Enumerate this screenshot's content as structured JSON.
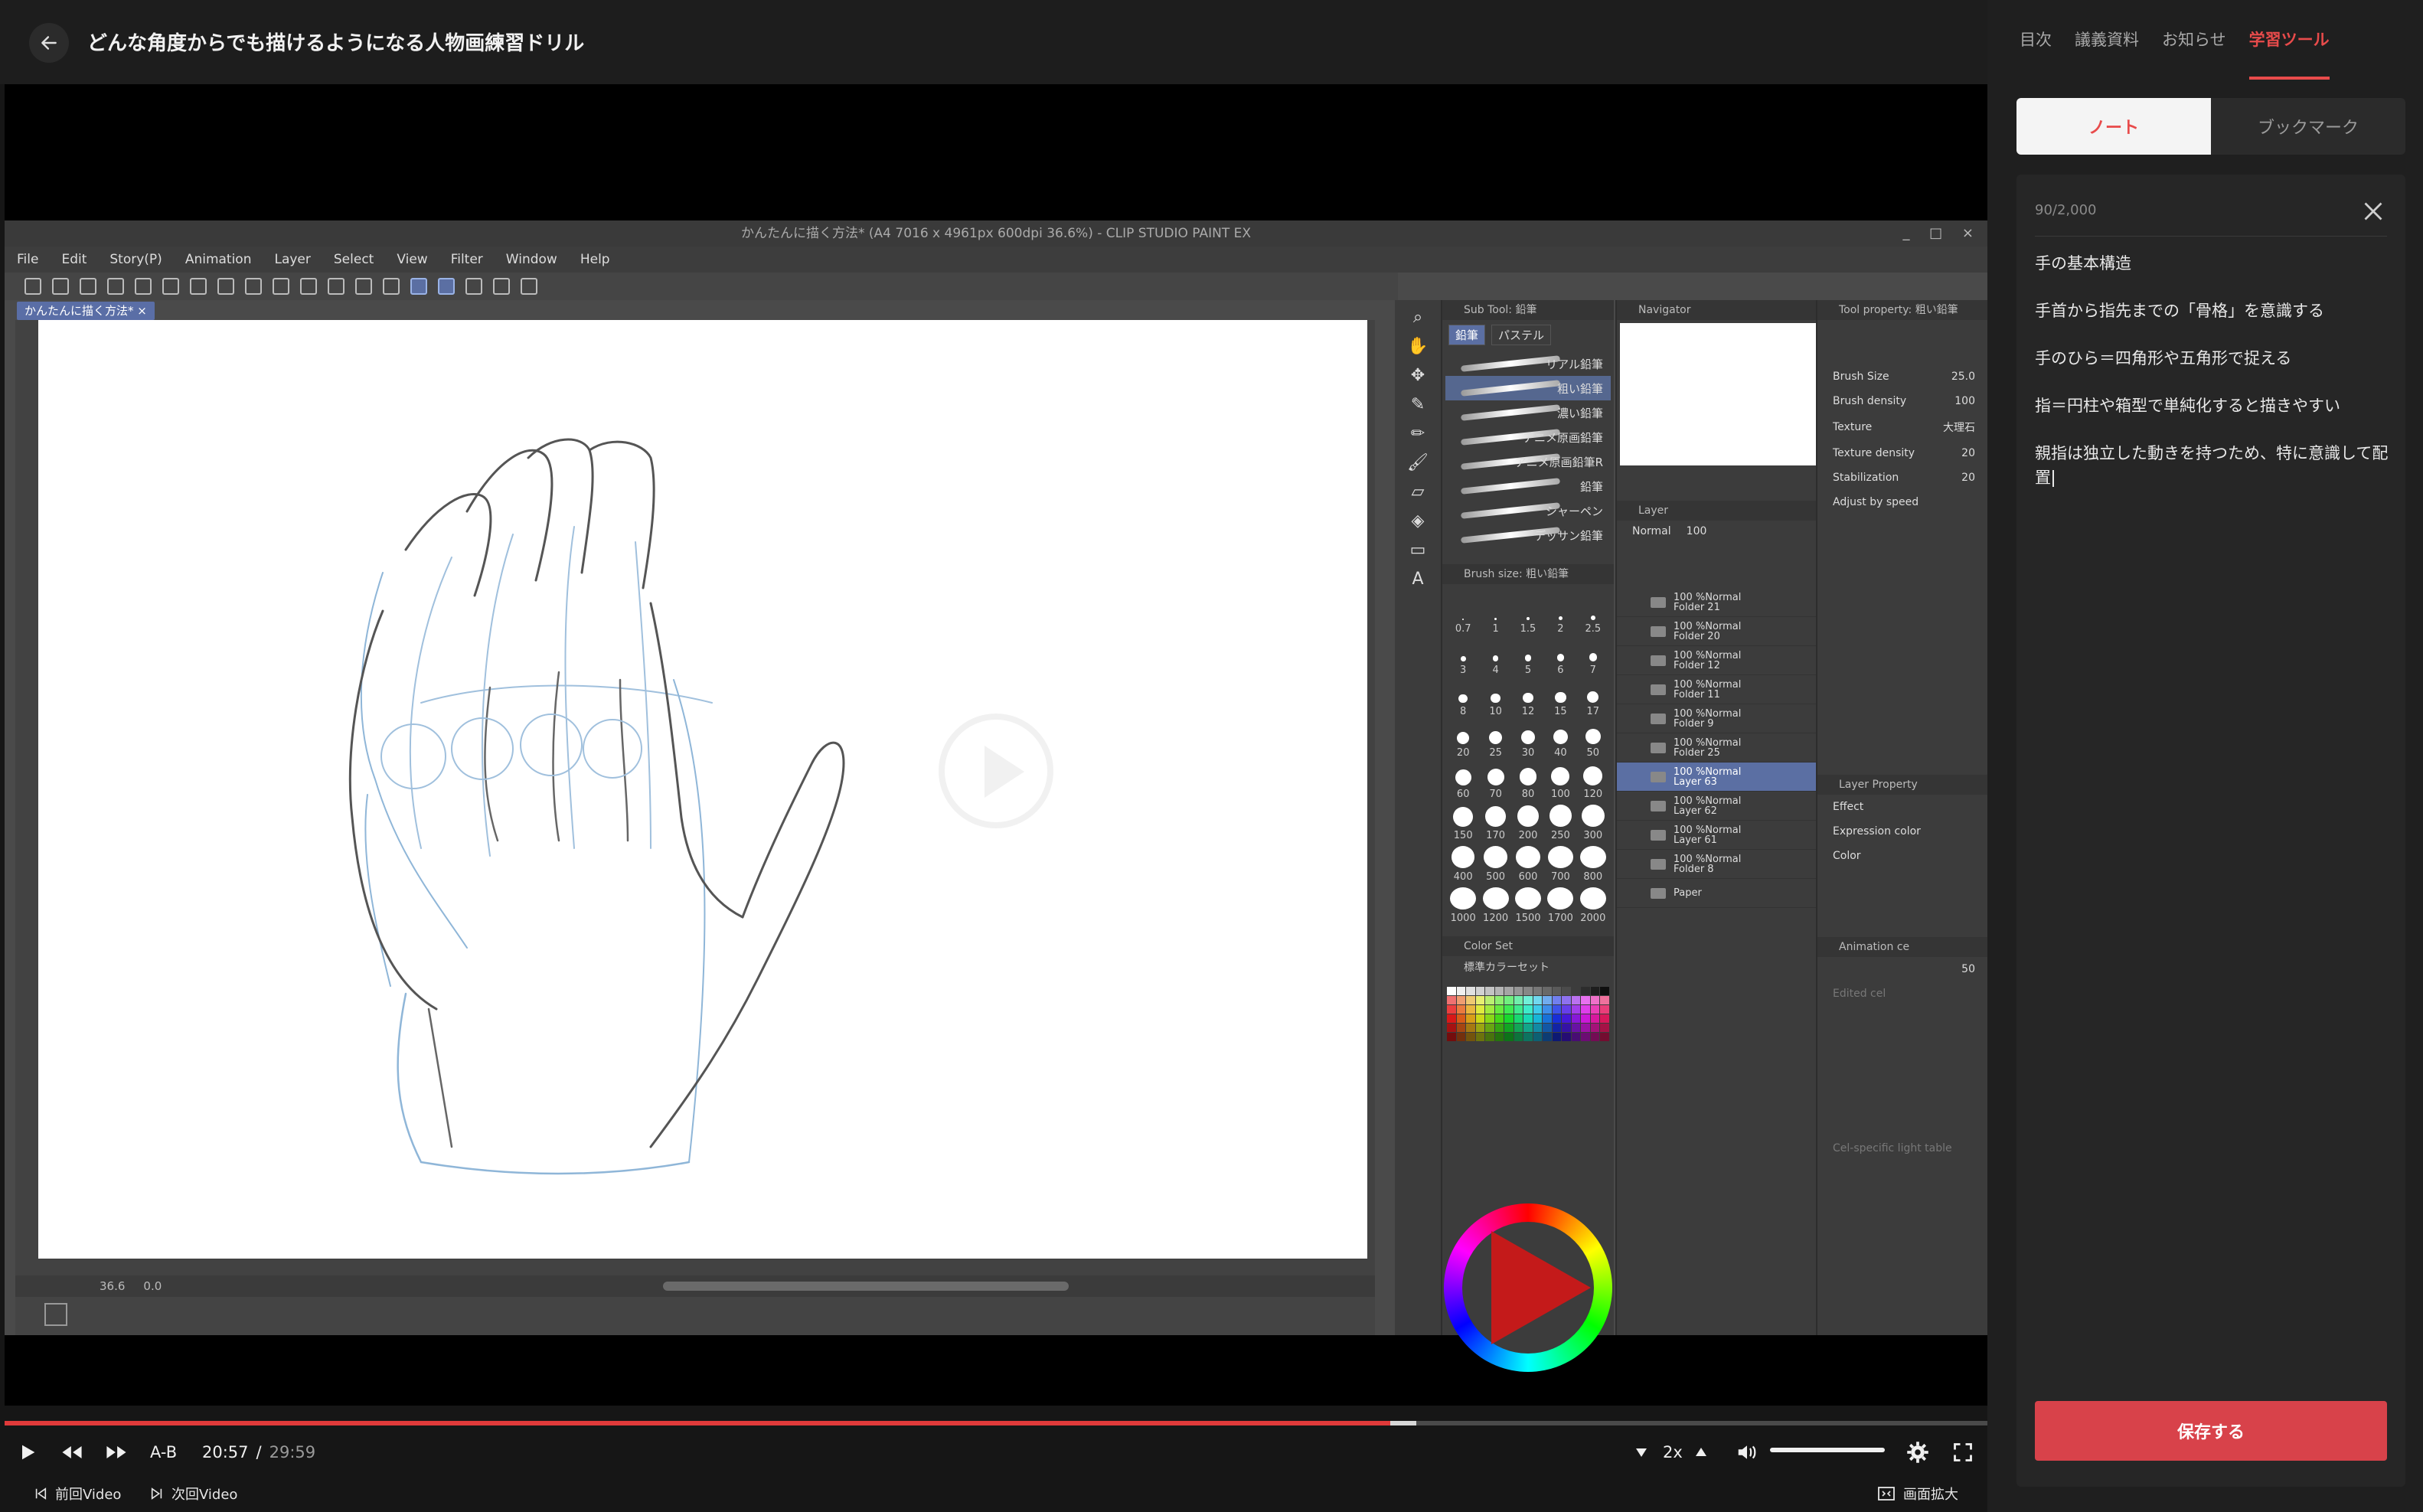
{
  "header": {
    "title": "どんな角度からでも描けるようになる人物画練習ドリル"
  },
  "csp": {
    "window_title": "かんたんに描く方法* (A4 7016 x 4961px 600dpi 36.6%) - CLIP STUDIO PAINT EX",
    "menu": [
      "File",
      "Edit",
      "Story(P)",
      "Animation",
      "Layer",
      "Select",
      "View",
      "Filter",
      "Window",
      "Help"
    ],
    "doc_tab": "かんたんに描く方法* ×",
    "zoom": "36.6",
    "angle": "0.0",
    "subtool_header": "Sub Tool: 鉛筆",
    "subtool_tabs": [
      "鉛筆",
      "パステル"
    ],
    "brushes": [
      "リアル鉛筆",
      "粗い鉛筆",
      "濃い鉛筆",
      "アニメ原画鉛筆",
      "アニメ原画鉛筆R",
      "鉛筆",
      "シャーペン",
      "デッサン鉛筆"
    ],
    "brush_size_header": "Brush size: 粗い鉛筆",
    "brush_sizes": [
      "0.7",
      "1",
      "1.5",
      "2",
      "2.5",
      "3",
      "4",
      "5",
      "6",
      "7",
      "8",
      "10",
      "12",
      "15",
      "17",
      "20",
      "25",
      "30",
      "40",
      "50",
      "60",
      "70",
      "80",
      "100",
      "120",
      "150",
      "170",
      "200",
      "250",
      "300",
      "400",
      "500",
      "600",
      "700",
      "800",
      "1000",
      "1200",
      "1500",
      "1700",
      "2000"
    ],
    "color_set_header": "Color Set",
    "color_set_name": "標準カラーセット",
    "navigator_header": "Navigator",
    "layer_header": "Layer",
    "blend_mode": "Normal",
    "opacity": "100",
    "layers": [
      {
        "title": "100 %Normal",
        "name": "Folder 21"
      },
      {
        "title": "100 %Normal",
        "name": "Folder 20"
      },
      {
        "title": "100 %Normal",
        "name": "Folder 12"
      },
      {
        "title": "100 %Normal",
        "name": "Folder 11"
      },
      {
        "title": "100 %Normal",
        "name": "Folder 9"
      },
      {
        "title": "100 %Normal",
        "name": "Folder 25"
      },
      {
        "title": "100 %Normal",
        "name": "Layer 63"
      },
      {
        "title": "100 %Normal",
        "name": "Layer 62"
      },
      {
        "title": "100 %Normal",
        "name": "Layer 61"
      },
      {
        "title": "100 %Normal",
        "name": "Folder 8"
      },
      {
        "title": "",
        "name": "Paper"
      }
    ],
    "tool_property_header": "Tool property: 粗い鉛筆",
    "props": [
      {
        "label": "Brush Size",
        "value": "25.0"
      },
      {
        "label": "Brush density",
        "value": "100"
      },
      {
        "label": "Texture",
        "value": "大理石"
      },
      {
        "label": "Texture density",
        "value": "20"
      },
      {
        "label": "Stabilization",
        "value": "20"
      }
    ],
    "adjust_speed": "Adjust by speed",
    "layer_property_header": "Layer Property",
    "effect_label": "Effect",
    "expression_color_label": "Expression color",
    "expression_color_value": "Color",
    "animation_header": "Animation ce",
    "animation_value": "50",
    "edited_cel": "Edited cel",
    "cel_light_table": "Cel-specific light table"
  },
  "player": {
    "ab_label": "A-B",
    "time_current": "20:57",
    "time_separator": "/",
    "time_total": "29:59",
    "progress_fraction": 0.699,
    "buffer_fraction": 0.712,
    "speed": "2x",
    "volume_fraction": 1.0,
    "prev_label": "前回Video",
    "next_label": "次回Video",
    "expand_label": "画面拡大"
  },
  "side": {
    "tabs": [
      "目次",
      "議義資料",
      "お知らせ",
      "学習ツール"
    ],
    "active_tab": "学習ツール",
    "segment": {
      "note": "ノート",
      "bookmark": "ブックマーク"
    },
    "char_count": "90/2,000",
    "notes": [
      "手の基本構造",
      "手首から指先までの「骨格」を意識する",
      "手のひら＝四角形や五角形で捉える",
      "指＝円柱や箱型で単純化すると描きやすい",
      "親指は独立した動きを持つため、特に意識して配置"
    ],
    "save_label": "保存する"
  },
  "colors": {
    "accent": "#e84b4b",
    "save_button": "#d8424a",
    "progress": "#e03a3a"
  }
}
